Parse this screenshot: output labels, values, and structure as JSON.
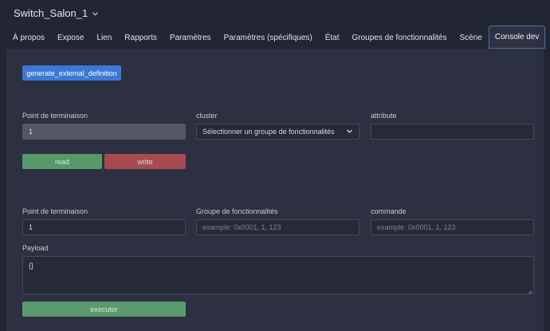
{
  "header": {
    "title": "Switch_Salon_1",
    "dropdown_icon": "chevron-down-icon"
  },
  "tabs": [
    {
      "label": "À propos"
    },
    {
      "label": "Expose"
    },
    {
      "label": "Lien"
    },
    {
      "label": "Rapports"
    },
    {
      "label": "Paramètres"
    },
    {
      "label": "Paramètres (spécifiques)"
    },
    {
      "label": "État"
    },
    {
      "label": "Groupes de fonctionnalités"
    },
    {
      "label": "Scène"
    },
    {
      "label": "Console dev",
      "active": true
    }
  ],
  "read_section": {
    "generate_button": "generate_external_definition",
    "endpoint_label": "Point de terminaison",
    "endpoint_value": "1",
    "cluster_label": "cluster",
    "cluster_value": "Sélectionner un groupe de fonctionnalités",
    "attribute_label": "attribute",
    "attribute_value": "",
    "read_button": "read",
    "write_button": "write"
  },
  "command_section": {
    "endpoint_label": "Point de terminaison",
    "endpoint_value": "1",
    "cluster_label": "Groupe de fonctionnalités",
    "cluster_placeholder": "example: 0x0001, 1, 123",
    "command_label": "commande",
    "command_placeholder": "example: 0x0001, 1, 123",
    "payload_label": "Payload",
    "payload_value": "{}",
    "execute_button": "executer"
  },
  "colors": {
    "background": "#222632",
    "panel": "#2c3040",
    "primary": "#3b78d8",
    "success": "#58996a",
    "danger": "#a64c50",
    "active_tab_border": "#4a73a8"
  }
}
